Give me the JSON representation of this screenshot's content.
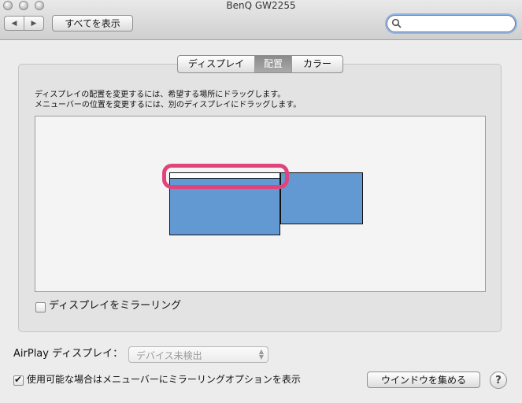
{
  "window": {
    "title": "BenQ GW2255"
  },
  "toolbar": {
    "back_icon": "back-arrow-icon",
    "forward_icon": "forward-arrow-icon",
    "show_all_label": "すべてを表示",
    "search": {
      "value": "",
      "placeholder": ""
    }
  },
  "tabs": [
    {
      "label": "ディスプレイ",
      "active": false
    },
    {
      "label": "配置",
      "active": true
    },
    {
      "label": "カラー",
      "active": false
    }
  ],
  "instructions": {
    "line1": "ディスプレイの配置を変更するには、希望する場所にドラッグします。",
    "line2": "メニューバーの位置を変更するには、別のディスプレイにドラッグします。"
  },
  "arrangement": {
    "displays": [
      {
        "name": "main-display",
        "has_menubar": true,
        "color": "#6299d3"
      },
      {
        "name": "secondary-display",
        "has_menubar": false,
        "color": "#6299d3"
      }
    ],
    "highlight_color": "#e0447a"
  },
  "mirror": {
    "label": "ディスプレイをミラーリング",
    "checked": false
  },
  "airplay": {
    "label": "AirPlay ディスプレイ：",
    "selected": "デバイス未検出",
    "enabled": false
  },
  "menu_option": {
    "label": "使用可能な場合はメニューバーにミラーリングオプションを表示",
    "checked": true
  },
  "buttons": {
    "gather_windows": "ウインドウを集める",
    "help": "?"
  }
}
